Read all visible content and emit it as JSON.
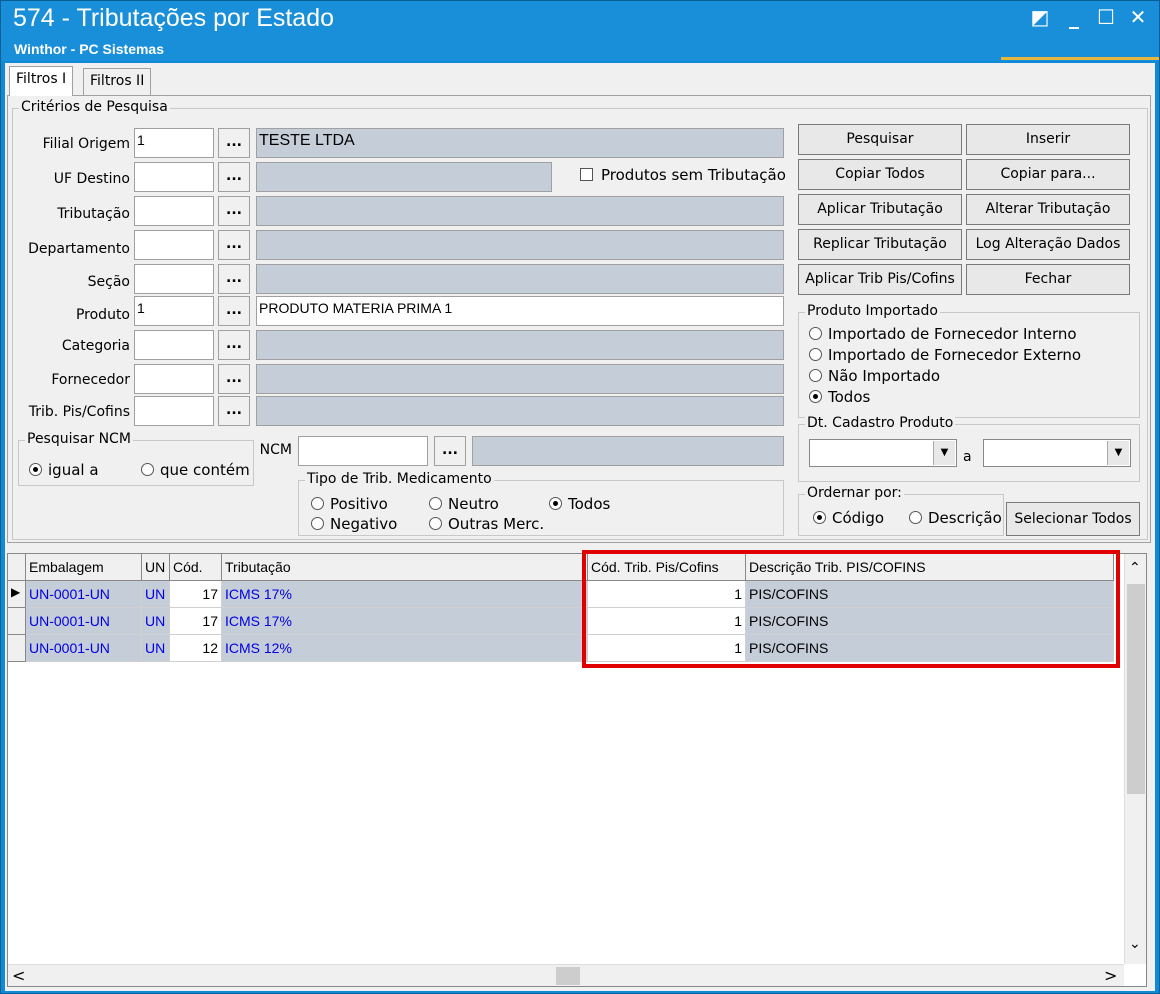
{
  "window": {
    "title": "574 - Tributações por Estado",
    "subtitle": "Winthor - PC Sistemas",
    "controls": [
      "◩",
      "_",
      "☐",
      "✕"
    ]
  },
  "tabs": [
    {
      "label": "Filtros I"
    },
    {
      "label": "Filtros II"
    }
  ],
  "criterios": {
    "legend": "Critérios de Pesquisa",
    "fields": [
      {
        "label": "Filial Origem",
        "code": "1",
        "desc": "TESTE  LTDA"
      },
      {
        "label": "UF Destino",
        "code": "",
        "desc": ""
      },
      {
        "label": "Tributação",
        "code": "",
        "desc": ""
      },
      {
        "label": "Departamento",
        "code": "",
        "desc": ""
      },
      {
        "label": "Seção",
        "code": "",
        "desc": ""
      },
      {
        "label": "Produto",
        "code": "1",
        "desc": "PRODUTO MATERIA PRIMA 1"
      },
      {
        "label": "Categoria",
        "code": "",
        "desc": ""
      },
      {
        "label": "Fornecedor",
        "code": "",
        "desc": ""
      },
      {
        "label": "Trib. Pis/Cofins",
        "code": "",
        "desc": ""
      }
    ],
    "dots": "...",
    "produtos_sem_tributacao": "Produtos sem Tributação",
    "ncm_label": "NCM",
    "ncm_value": ""
  },
  "pesquisar_ncm": {
    "legend": "Pesquisar NCM",
    "options": [
      "igual a",
      "que contém"
    ],
    "selected": 0
  },
  "tipo_trib": {
    "legend": "Tipo de Trib. Medicamento",
    "options": [
      "Positivo",
      "Neutro",
      "Todos",
      "Negativo",
      "Outras Merc."
    ],
    "selected": 2
  },
  "buttons": [
    "Pesquisar",
    "Inserir",
    "Copiar Todos",
    "Copiar para...",
    "Aplicar Tributação",
    "Alterar Tributação",
    "Replicar Tributação",
    "Log Alteração Dados",
    "Aplicar Trib Pis/Cofins",
    "Fechar"
  ],
  "produto_importado": {
    "legend": "Produto Importado",
    "options": [
      "Importado de Fornecedor Interno",
      "Importado de Fornecedor Externo",
      "Não Importado",
      "Todos"
    ],
    "selected": 3
  },
  "dt_cadastro": {
    "legend": "Dt. Cadastro Produto",
    "separator": "a"
  },
  "ordenar": {
    "legend": "Ordernar por:",
    "options": [
      "Código",
      "Descrição"
    ],
    "selected": 0
  },
  "selecionar_todos": "Selecionar Todos",
  "grid": {
    "columns": [
      "Embalagem",
      "UN",
      "Cód.",
      "Tributação",
      "Cód. Trib. Pis/Cofins",
      "Descrição Trib. PIS/COFINS"
    ],
    "rows": [
      [
        "UN-0001-UN",
        "UN",
        "17",
        "ICMS 17%",
        "1",
        "PIS/COFINS"
      ],
      [
        "UN-0001-UN",
        "UN",
        "17",
        "ICMS 17%",
        "1",
        "PIS/COFINS"
      ],
      [
        "UN-0001-UN",
        "UN",
        "12",
        "ICMS 12%",
        "1",
        "PIS/COFINS"
      ]
    ],
    "row_indicator": "▶",
    "scroll_up": "⌃",
    "scroll_down": "⌄",
    "scroll_left": "<",
    "scroll_right": ">"
  },
  "colors": {
    "highlight_box": "#e00000",
    "title_bar": "#1a8fd9",
    "grid_text": "#0000e0"
  }
}
